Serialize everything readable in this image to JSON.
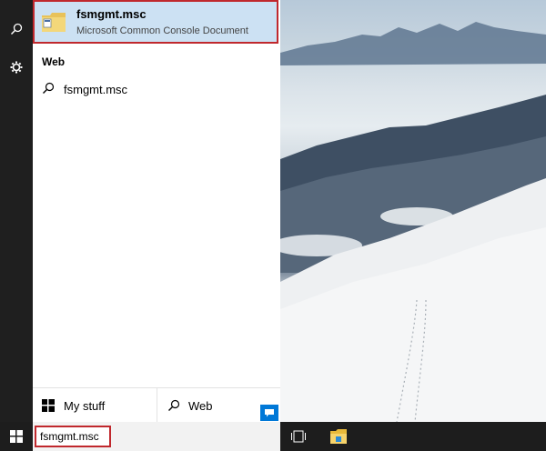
{
  "best_match": {
    "title": "fsmgmt.msc",
    "subtitle": "Microsoft Common Console Document",
    "icon": "console-document-icon"
  },
  "web_section": {
    "title": "Web",
    "items": [
      {
        "label": "fsmgmt.msc",
        "icon": "search-icon"
      }
    ]
  },
  "bottom_tabs": {
    "my_stuff": "My stuff",
    "web": "Web"
  },
  "taskbar": {
    "search_value": "fsmgmt.msc"
  },
  "rail": {
    "icons": [
      "search-icon",
      "gear-icon"
    ]
  },
  "colors": {
    "accent": "#0078d7",
    "selection": "#cce1f3",
    "highlight_border": "#c0282d"
  }
}
